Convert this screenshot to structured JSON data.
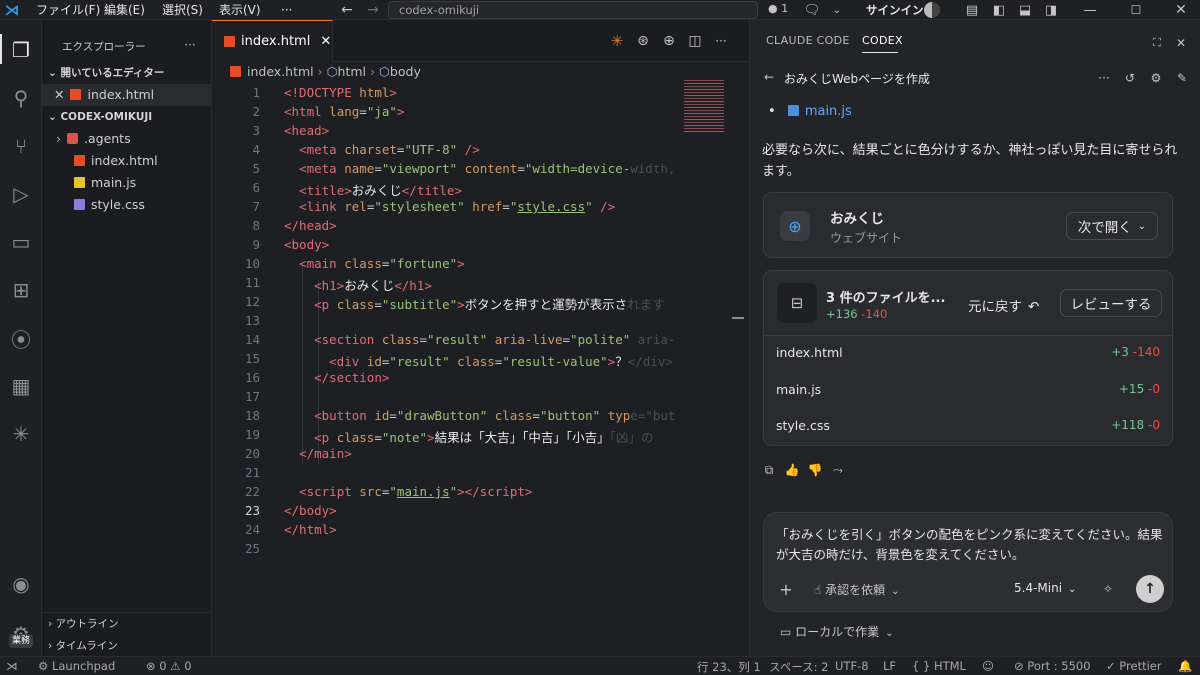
{
  "titlebar": {
    "menu": [
      "ファイル(F)",
      "編集(E)",
      "選択(S)",
      "表示(V)",
      "···"
    ],
    "search": "codex-omikuji",
    "notif_count": "1",
    "signin": "サインイン"
  },
  "sidebar": {
    "title": "エクスプローラー",
    "open_editors": "開いているエディター",
    "open_file": "index.html",
    "project": "CODEX-OMIKUJI",
    "files": [
      {
        "name": ".agents",
        "type": "folder"
      },
      {
        "name": "index.html",
        "type": "html"
      },
      {
        "name": "main.js",
        "type": "js"
      },
      {
        "name": "style.css",
        "type": "css"
      }
    ],
    "outline": "アウトライン",
    "timeline": "タイムライン"
  },
  "editor": {
    "tab": "index.html",
    "crumbs": [
      "index.html",
      "html",
      "body"
    ],
    "line_numbers": [
      "1",
      "2",
      "3",
      "4",
      "5",
      "6",
      "7",
      "8",
      "9",
      "10",
      "11",
      "12",
      "13",
      "14",
      "15",
      "16",
      "17",
      "18",
      "19",
      "20",
      "21",
      "22",
      "23",
      "24",
      "25"
    ],
    "current_line": "23"
  },
  "panel": {
    "tabs": [
      "CLAUDE CODE",
      "CODEX"
    ],
    "thread_title": "おみくじWebページを作成",
    "list_file": "main.js",
    "message": "必要なら次に、結果ごとに色分けするか、神社っぽい見た目に寄せられます。",
    "site_card": {
      "title": "おみくじ",
      "subtitle": "ウェブサイト",
      "open_label": "次で開く"
    },
    "changes": {
      "title": "3 件のファイルを...",
      "added": "+136",
      "removed": "-140",
      "undo": "元に戻す",
      "review": "レビューする",
      "files": [
        {
          "name": "index.html",
          "add": "+3",
          "del": "-140"
        },
        {
          "name": "main.js",
          "add": "+15",
          "del": "-0"
        },
        {
          "name": "style.css",
          "add": "+118",
          "del": "-0"
        }
      ]
    },
    "input_text": "「おみくじを引く」ボタンの配色をピンク系に変えてください。結果が大吉の時だけ、背景色を変えてください。",
    "approval": "承認を依頼",
    "model": "5.4-Mini",
    "local": "ローカルで作業"
  },
  "statusbar": {
    "launchpad": "Launchpad",
    "errors": "0",
    "warnings": "0",
    "position": "行 23、列 1",
    "spaces": "スペース: 2",
    "encoding": "UTF-8",
    "eol": "LF",
    "language": "HTML",
    "port": "Port : 5500",
    "prettier": "Prettier",
    "badge": "業務"
  },
  "colors": {
    "accent": "#e07a2e",
    "added": "#73c991",
    "removed": "#f14c4c"
  }
}
